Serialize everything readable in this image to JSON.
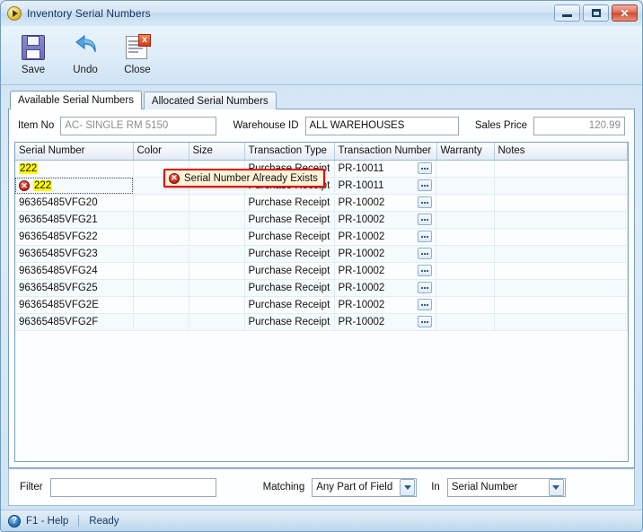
{
  "window": {
    "title": "Inventory Serial Numbers",
    "title_icon": "app-orb-icon",
    "controls": {
      "minimize": "minimize-button",
      "maximize": "maximize-button",
      "close": "close-button",
      "close_glyph": "✕"
    }
  },
  "toolbar": {
    "buttons": [
      {
        "label": "Save",
        "icon": "floppy-disk-icon"
      },
      {
        "label": "Undo",
        "icon": "undo-arrow-icon"
      },
      {
        "label": "Close",
        "icon": "close-document-icon"
      }
    ]
  },
  "tabs": [
    {
      "label": "Available Serial Numbers",
      "active": true
    },
    {
      "label": "Allocated Serial Numbers",
      "active": false
    }
  ],
  "fields": {
    "item_no": {
      "label": "Item No",
      "value": "AC- SINGLE RM 5150",
      "readonly": true
    },
    "warehouse_id": {
      "label": "Warehouse ID",
      "value": "ALL WAREHOUSES",
      "readonly": false
    },
    "sales_price": {
      "label": "Sales Price",
      "value": "120.99",
      "readonly": true
    }
  },
  "grid": {
    "columns": [
      "Serial Number",
      "Color",
      "Size",
      "Transaction Type",
      "Transaction Number",
      "Warranty",
      "Notes"
    ],
    "ellipsis_label": "…",
    "rows": [
      {
        "serial": "222",
        "highlight": true,
        "error": false,
        "color": "",
        "size": "",
        "type": "Purchase Receipt",
        "number": "PR-10011",
        "warranty": "",
        "notes": "",
        "ellipsis": true
      },
      {
        "serial": "222",
        "highlight": true,
        "error": true,
        "color": "",
        "size": "",
        "type": "Purchase Receipt",
        "number": "PR-10011",
        "warranty": "",
        "notes": "",
        "ellipsis": true
      },
      {
        "serial": "96365485VFG20",
        "highlight": false,
        "error": false,
        "color": "",
        "size": "",
        "type": "Purchase Receipt",
        "number": "PR-10002",
        "warranty": "",
        "notes": "",
        "ellipsis": true
      },
      {
        "serial": "96365485VFG21",
        "highlight": false,
        "error": false,
        "color": "",
        "size": "",
        "type": "Purchase Receipt",
        "number": "PR-10002",
        "warranty": "",
        "notes": "",
        "ellipsis": true
      },
      {
        "serial": "96365485VFG22",
        "highlight": false,
        "error": false,
        "color": "",
        "size": "",
        "type": "Purchase Receipt",
        "number": "PR-10002",
        "warranty": "",
        "notes": "",
        "ellipsis": true
      },
      {
        "serial": "96365485VFG23",
        "highlight": false,
        "error": false,
        "color": "",
        "size": "",
        "type": "Purchase Receipt",
        "number": "PR-10002",
        "warranty": "",
        "notes": "",
        "ellipsis": true
      },
      {
        "serial": "96365485VFG24",
        "highlight": false,
        "error": false,
        "color": "",
        "size": "",
        "type": "Purchase Receipt",
        "number": "PR-10002",
        "warranty": "",
        "notes": "",
        "ellipsis": true
      },
      {
        "serial": "96365485VFG25",
        "highlight": false,
        "error": false,
        "color": "",
        "size": "",
        "type": "Purchase Receipt",
        "number": "PR-10002",
        "warranty": "",
        "notes": "",
        "ellipsis": true
      },
      {
        "serial": "96365485VFG2E",
        "highlight": false,
        "error": false,
        "color": "",
        "size": "",
        "type": "Purchase Receipt",
        "number": "PR-10002",
        "warranty": "",
        "notes": "",
        "ellipsis": true
      },
      {
        "serial": "96365485VFG2F",
        "highlight": false,
        "error": false,
        "color": "",
        "size": "",
        "type": "Purchase Receipt",
        "number": "PR-10002",
        "warranty": "",
        "notes": "",
        "ellipsis": true
      }
    ]
  },
  "error_tooltip": {
    "message": "Serial Number Already Exists",
    "icon": "error-circle-icon",
    "glyph": "✕"
  },
  "filter": {
    "label": "Filter",
    "value": "",
    "matching_label": "Matching",
    "matching_value": "Any Part of Field",
    "in_label": "In",
    "in_value": "Serial Number"
  },
  "statusbar": {
    "help_icon": "help-circle-icon",
    "help_glyph": "?",
    "help_text": "F1 - Help",
    "status": "Ready"
  },
  "colors": {
    "accent": "#2d5a8e",
    "error": "#e00000",
    "highlight": "#ffff00",
    "tooltip_bg": "#fdf3d8"
  }
}
